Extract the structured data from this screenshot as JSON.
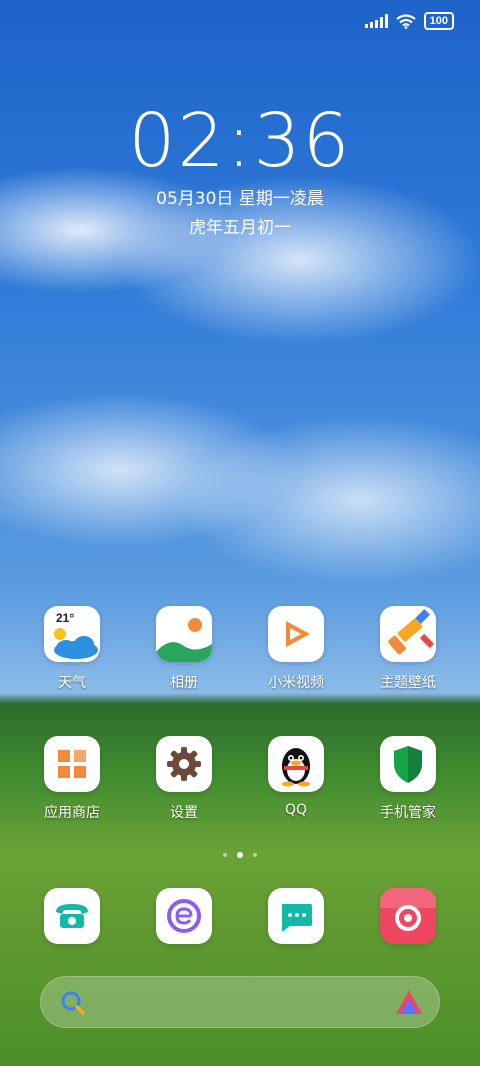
{
  "status": {
    "battery": "100",
    "wifi_icon": "wifi-icon",
    "signal_icon": "signal-icon"
  },
  "lockclock": {
    "time": "02:36",
    "date": "05月30日 星期一凌晨",
    "lunar": "虎年五月初一"
  },
  "apps_row1": [
    {
      "label": "天气",
      "icon": "weather-icon",
      "temp": "21°"
    },
    {
      "label": "相册",
      "icon": "gallery-icon"
    },
    {
      "label": "小米视频",
      "icon": "video-icon"
    },
    {
      "label": "主题壁纸",
      "icon": "themes-icon"
    }
  ],
  "apps_row2": [
    {
      "label": "应用商店",
      "icon": "app-store-icon"
    },
    {
      "label": "设置",
      "icon": "settings-gear-icon"
    },
    {
      "label": "QQ",
      "icon": "qq-penguin-icon"
    },
    {
      "label": "手机管家",
      "icon": "security-shield-icon"
    }
  ],
  "dock": [
    {
      "name": "phone",
      "icon": "phone-icon"
    },
    {
      "name": "browser",
      "icon": "browser-icon"
    },
    {
      "name": "messages",
      "icon": "messages-icon"
    },
    {
      "name": "camera",
      "icon": "camera-icon"
    }
  ],
  "page_indicator": {
    "pages": 3,
    "current": 2
  },
  "colors": {
    "sky": "#1e63c9",
    "grass": "#4d8e28",
    "video_orange": "#f08a3c",
    "shield_green": "#16a34a",
    "camera_red": "#ef4760",
    "messages_teal": "#14b8a6"
  }
}
